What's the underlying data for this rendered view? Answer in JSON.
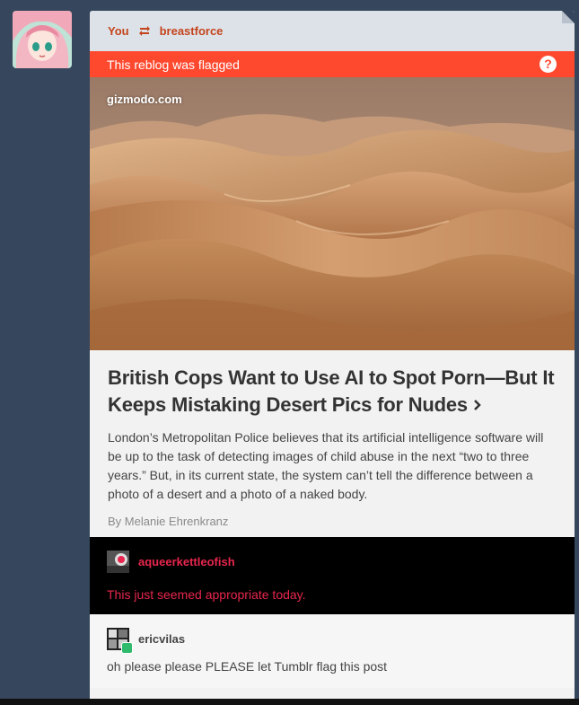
{
  "header": {
    "user": "You",
    "reblogged_from": "breastforce",
    "reblog_icon": "reblog-icon"
  },
  "flag": {
    "text": "This reblog was flagged",
    "help_glyph": "?"
  },
  "link_card": {
    "source": "gizmodo.com",
    "title": "British Cops Want to Use AI to Spot Porn—But It Keeps Mistaking Desert Pics for Nudes",
    "excerpt": "London’s Metropolitan Police believes that its artificial intelligence software will be up to the task of detecting images of child abuse in the next “two to three years.” But, in its current state, the system can’t tell the difference between a photo of a desert and a photo of a naked body.",
    "byline": "By Melanie Ehrenkranz"
  },
  "trail": [
    {
      "username": "aqueerkettleofish",
      "text": "This just seemed appropriate today."
    },
    {
      "username": "ericvilas",
      "text": "oh please please PLEASE let Tumblr flag this post"
    }
  ],
  "colors": {
    "background": "#36465d",
    "flag": "#ff492f",
    "username_accent": "#c4441c",
    "trail_dark_text": "#e8264d"
  }
}
